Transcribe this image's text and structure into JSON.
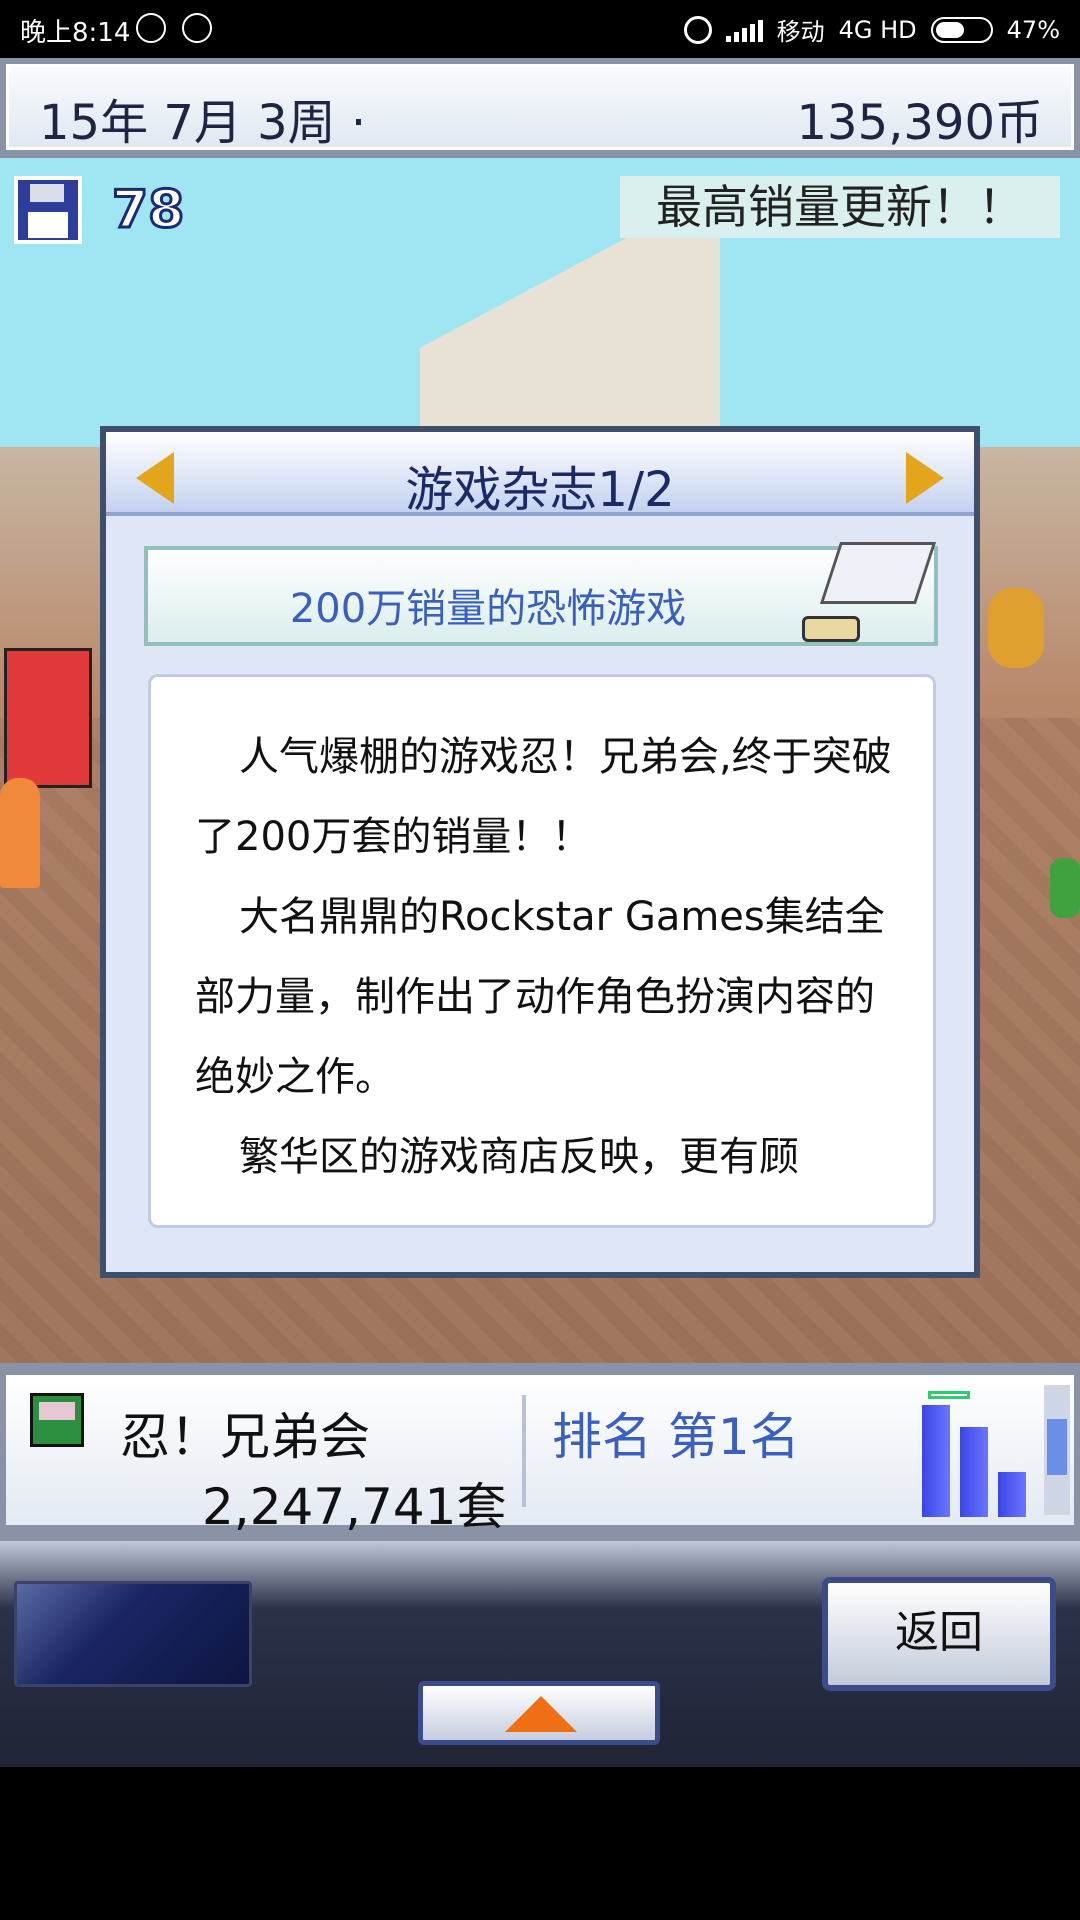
{
  "status_bar": {
    "time": "晚上8:14",
    "carrier": "移动",
    "network": "4G HD",
    "battery": "47%"
  },
  "top_bar": {
    "date": "15年 7月 3周 ·",
    "money": "135,390币"
  },
  "scene": {
    "save_count": "78",
    "toast": "最高销量更新！！"
  },
  "dialog": {
    "title": "游戏杂志1/2",
    "headline": "200万销量的恐怖游戏",
    "paragraphs": [
      "人气爆棚的游戏忍！兄弟会,终于突破了200万套的销量！！",
      "大名鼎鼎的Rockstar Games集结全部力量，制作出了动作角色扮演内容的绝妙之作。",
      "繁华区的游戏商店反映，更有顾"
    ]
  },
  "info_panel": {
    "game_name": "忍！兄弟会",
    "sales": "2,247,741套",
    "rank": "排名 第1名",
    "chart_levels": [
      1.0,
      0.8,
      0.4
    ]
  },
  "menu": {
    "back_label": "返回"
  },
  "colors": {
    "accent_arrow": "#e2a51b",
    "rank_blue": "#3a5fc2",
    "up_arrow": "#ef6f12"
  }
}
